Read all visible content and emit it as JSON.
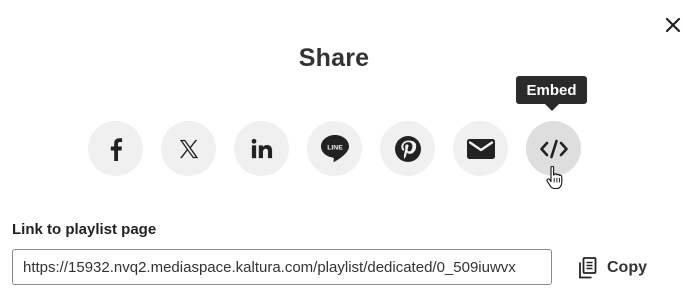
{
  "dialog": {
    "title": "Share",
    "close_icon": "close-icon"
  },
  "tooltip": {
    "text": "Embed"
  },
  "share_buttons": [
    {
      "id": "facebook",
      "icon": "facebook-icon"
    },
    {
      "id": "x",
      "icon": "x-twitter-icon"
    },
    {
      "id": "linkedin",
      "icon": "linkedin-icon"
    },
    {
      "id": "line",
      "icon": "line-icon",
      "text": "LINE"
    },
    {
      "id": "pinterest",
      "icon": "pinterest-icon"
    },
    {
      "id": "email",
      "icon": "email-icon"
    },
    {
      "id": "embed",
      "icon": "embed-code-icon",
      "state": "hovered"
    }
  ],
  "link": {
    "label": "Link to playlist page",
    "value": "https://15932.nvq2.mediaspace.kaltura.com/playlist/dedicated/0_509iuwvx"
  },
  "copy": {
    "label": "Copy",
    "icon": "copy-icon"
  },
  "colors": {
    "button_bg": "#f0f0f0",
    "button_hover_bg": "#dedede",
    "icon": "#222222",
    "tooltip_bg": "#2b2b2b"
  }
}
